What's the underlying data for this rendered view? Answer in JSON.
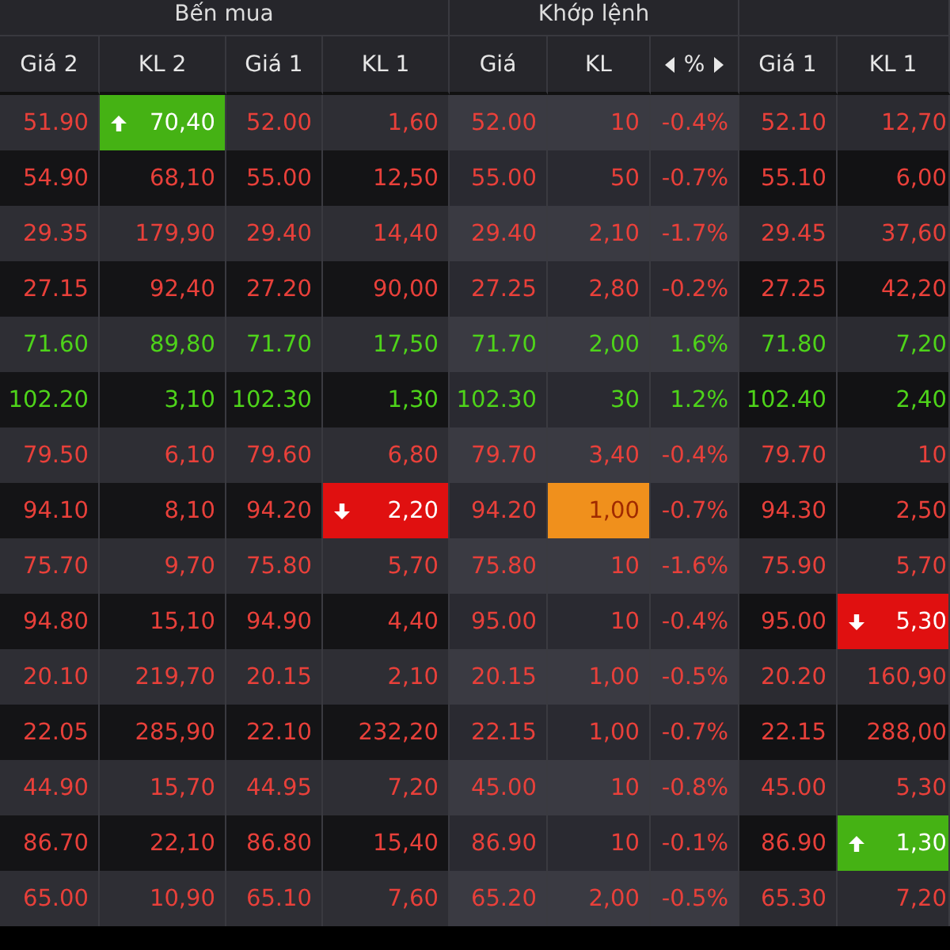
{
  "groups": [
    {
      "title": "Bến mua",
      "columns": [
        {
          "label": "Giá 2"
        },
        {
          "label": "KL 2"
        },
        {
          "label": "Giá 1"
        },
        {
          "label": "KL 1"
        }
      ]
    },
    {
      "title": "Khớp lệnh",
      "columns": [
        {
          "label": "Giá"
        },
        {
          "label": "KL"
        },
        {
          "label": "%",
          "arrows": true
        }
      ]
    },
    {
      "columns": [
        {
          "label": "Giá 1"
        },
        {
          "label": "KL 1"
        }
      ]
    }
  ],
  "rows": [
    {
      "rising": false,
      "cells": [
        {
          "text": "51.90",
          "kind": "plain"
        },
        {
          "text": "70,40",
          "kind": "up"
        },
        {
          "text": "52.00",
          "kind": "plain"
        },
        {
          "text": "1,60",
          "kind": "plain"
        },
        {
          "text": "52.00",
          "kind": "plain"
        },
        {
          "text": "10",
          "kind": "plain"
        },
        {
          "text": "-0.4%",
          "kind": "plain"
        },
        {
          "text": "52.10",
          "kind": "plain"
        },
        {
          "text": "12,70",
          "kind": "plain"
        }
      ]
    },
    {
      "rising": false,
      "cells": [
        {
          "text": "54.90",
          "kind": "plain"
        },
        {
          "text": "68,10",
          "kind": "plain"
        },
        {
          "text": "55.00",
          "kind": "plain"
        },
        {
          "text": "12,50",
          "kind": "plain"
        },
        {
          "text": "55.00",
          "kind": "plain"
        },
        {
          "text": "50",
          "kind": "plain"
        },
        {
          "text": "-0.7%",
          "kind": "plain"
        },
        {
          "text": "55.10",
          "kind": "plain"
        },
        {
          "text": "6,00",
          "kind": "plain"
        }
      ]
    },
    {
      "rising": false,
      "cells": [
        {
          "text": "29.35",
          "kind": "plain"
        },
        {
          "text": "179,90",
          "kind": "plain"
        },
        {
          "text": "29.40",
          "kind": "plain"
        },
        {
          "text": "14,40",
          "kind": "plain"
        },
        {
          "text": "29.40",
          "kind": "plain"
        },
        {
          "text": "2,10",
          "kind": "plain"
        },
        {
          "text": "-1.7%",
          "kind": "plain"
        },
        {
          "text": "29.45",
          "kind": "plain"
        },
        {
          "text": "37,60",
          "kind": "plain"
        }
      ]
    },
    {
      "rising": false,
      "cells": [
        {
          "text": "27.15",
          "kind": "plain"
        },
        {
          "text": "92,40",
          "kind": "plain"
        },
        {
          "text": "27.20",
          "kind": "plain"
        },
        {
          "text": "90,00",
          "kind": "plain"
        },
        {
          "text": "27.25",
          "kind": "plain"
        },
        {
          "text": "2,80",
          "kind": "plain"
        },
        {
          "text": "-0.2%",
          "kind": "plain"
        },
        {
          "text": "27.25",
          "kind": "plain"
        },
        {
          "text": "42,20",
          "kind": "plain"
        }
      ]
    },
    {
      "rising": true,
      "cells": [
        {
          "text": "71.60",
          "kind": "plain"
        },
        {
          "text": "89,80",
          "kind": "plain"
        },
        {
          "text": "71.70",
          "kind": "plain"
        },
        {
          "text": "17,50",
          "kind": "plain"
        },
        {
          "text": "71.70",
          "kind": "plain"
        },
        {
          "text": "2,00",
          "kind": "plain"
        },
        {
          "text": "1.6%",
          "kind": "plain"
        },
        {
          "text": "71.80",
          "kind": "plain"
        },
        {
          "text": "7,20",
          "kind": "plain"
        }
      ]
    },
    {
      "rising": true,
      "cells": [
        {
          "text": "102.20",
          "kind": "plain"
        },
        {
          "text": "3,10",
          "kind": "plain"
        },
        {
          "text": "102.30",
          "kind": "plain"
        },
        {
          "text": "1,30",
          "kind": "plain"
        },
        {
          "text": "102.30",
          "kind": "plain"
        },
        {
          "text": "30",
          "kind": "plain"
        },
        {
          "text": "1.2%",
          "kind": "plain"
        },
        {
          "text": "102.40",
          "kind": "plain"
        },
        {
          "text": "2,40",
          "kind": "plain"
        }
      ]
    },
    {
      "rising": false,
      "cells": [
        {
          "text": "79.50",
          "kind": "plain"
        },
        {
          "text": "6,10",
          "kind": "plain"
        },
        {
          "text": "79.60",
          "kind": "plain"
        },
        {
          "text": "6,80",
          "kind": "plain"
        },
        {
          "text": "79.70",
          "kind": "plain"
        },
        {
          "text": "3,40",
          "kind": "plain"
        },
        {
          "text": "-0.4%",
          "kind": "plain"
        },
        {
          "text": "79.70",
          "kind": "plain"
        },
        {
          "text": "10",
          "kind": "plain"
        }
      ]
    },
    {
      "rising": false,
      "cells": [
        {
          "text": "94.10",
          "kind": "plain"
        },
        {
          "text": "8,10",
          "kind": "plain"
        },
        {
          "text": "94.20",
          "kind": "plain"
        },
        {
          "text": "2,20",
          "kind": "down"
        },
        {
          "text": "94.20",
          "kind": "plain"
        },
        {
          "text": "1,00",
          "kind": "changed"
        },
        {
          "text": "-0.7%",
          "kind": "plain"
        },
        {
          "text": "94.30",
          "kind": "plain"
        },
        {
          "text": "2,50",
          "kind": "plain"
        }
      ]
    },
    {
      "rising": false,
      "cells": [
        {
          "text": "75.70",
          "kind": "plain"
        },
        {
          "text": "9,70",
          "kind": "plain"
        },
        {
          "text": "75.80",
          "kind": "plain"
        },
        {
          "text": "5,70",
          "kind": "plain"
        },
        {
          "text": "75.80",
          "kind": "plain"
        },
        {
          "text": "10",
          "kind": "plain"
        },
        {
          "text": "-1.6%",
          "kind": "plain"
        },
        {
          "text": "75.90",
          "kind": "plain"
        },
        {
          "text": "5,70",
          "kind": "plain"
        }
      ]
    },
    {
      "rising": false,
      "cells": [
        {
          "text": "94.80",
          "kind": "plain"
        },
        {
          "text": "15,10",
          "kind": "plain"
        },
        {
          "text": "94.90",
          "kind": "plain"
        },
        {
          "text": "4,40",
          "kind": "plain"
        },
        {
          "text": "95.00",
          "kind": "plain"
        },
        {
          "text": "10",
          "kind": "plain"
        },
        {
          "text": "-0.4%",
          "kind": "plain"
        },
        {
          "text": "95.00",
          "kind": "plain"
        },
        {
          "text": "5,30",
          "kind": "down"
        }
      ]
    },
    {
      "rising": false,
      "cells": [
        {
          "text": "20.10",
          "kind": "plain"
        },
        {
          "text": "219,70",
          "kind": "plain"
        },
        {
          "text": "20.15",
          "kind": "plain"
        },
        {
          "text": "2,10",
          "kind": "plain"
        },
        {
          "text": "20.15",
          "kind": "plain"
        },
        {
          "text": "1,00",
          "kind": "plain"
        },
        {
          "text": "-0.5%",
          "kind": "plain"
        },
        {
          "text": "20.20",
          "kind": "plain"
        },
        {
          "text": "160,90",
          "kind": "plain"
        }
      ]
    },
    {
      "rising": false,
      "cells": [
        {
          "text": "22.05",
          "kind": "plain"
        },
        {
          "text": "285,90",
          "kind": "plain"
        },
        {
          "text": "22.10",
          "kind": "plain"
        },
        {
          "text": "232,20",
          "kind": "plain"
        },
        {
          "text": "22.15",
          "kind": "plain"
        },
        {
          "text": "1,00",
          "kind": "plain"
        },
        {
          "text": "-0.7%",
          "kind": "plain"
        },
        {
          "text": "22.15",
          "kind": "plain"
        },
        {
          "text": "288,00",
          "kind": "plain"
        }
      ]
    },
    {
      "rising": false,
      "cells": [
        {
          "text": "44.90",
          "kind": "plain"
        },
        {
          "text": "15,70",
          "kind": "plain"
        },
        {
          "text": "44.95",
          "kind": "plain"
        },
        {
          "text": "7,20",
          "kind": "plain"
        },
        {
          "text": "45.00",
          "kind": "plain"
        },
        {
          "text": "10",
          "kind": "plain"
        },
        {
          "text": "-0.8%",
          "kind": "plain"
        },
        {
          "text": "45.00",
          "kind": "plain"
        },
        {
          "text": "5,30",
          "kind": "plain"
        }
      ]
    },
    {
      "rising": false,
      "cells": [
        {
          "text": "86.70",
          "kind": "plain"
        },
        {
          "text": "22,10",
          "kind": "plain"
        },
        {
          "text": "86.80",
          "kind": "plain"
        },
        {
          "text": "15,40",
          "kind": "plain"
        },
        {
          "text": "86.90",
          "kind": "plain"
        },
        {
          "text": "10",
          "kind": "plain"
        },
        {
          "text": "-0.1%",
          "kind": "plain"
        },
        {
          "text": "86.90",
          "kind": "plain"
        },
        {
          "text": "1,30",
          "kind": "up"
        }
      ]
    },
    {
      "rising": false,
      "cells": [
        {
          "text": "65.00",
          "kind": "plain"
        },
        {
          "text": "10,90",
          "kind": "plain"
        },
        {
          "text": "65.10",
          "kind": "plain"
        },
        {
          "text": "7,60",
          "kind": "plain"
        },
        {
          "text": "65.20",
          "kind": "plain"
        },
        {
          "text": "2,00",
          "kind": "plain"
        },
        {
          "text": "-0.5%",
          "kind": "plain"
        },
        {
          "text": "65.30",
          "kind": "plain"
        },
        {
          "text": "7,20",
          "kind": "plain"
        }
      ]
    }
  ]
}
